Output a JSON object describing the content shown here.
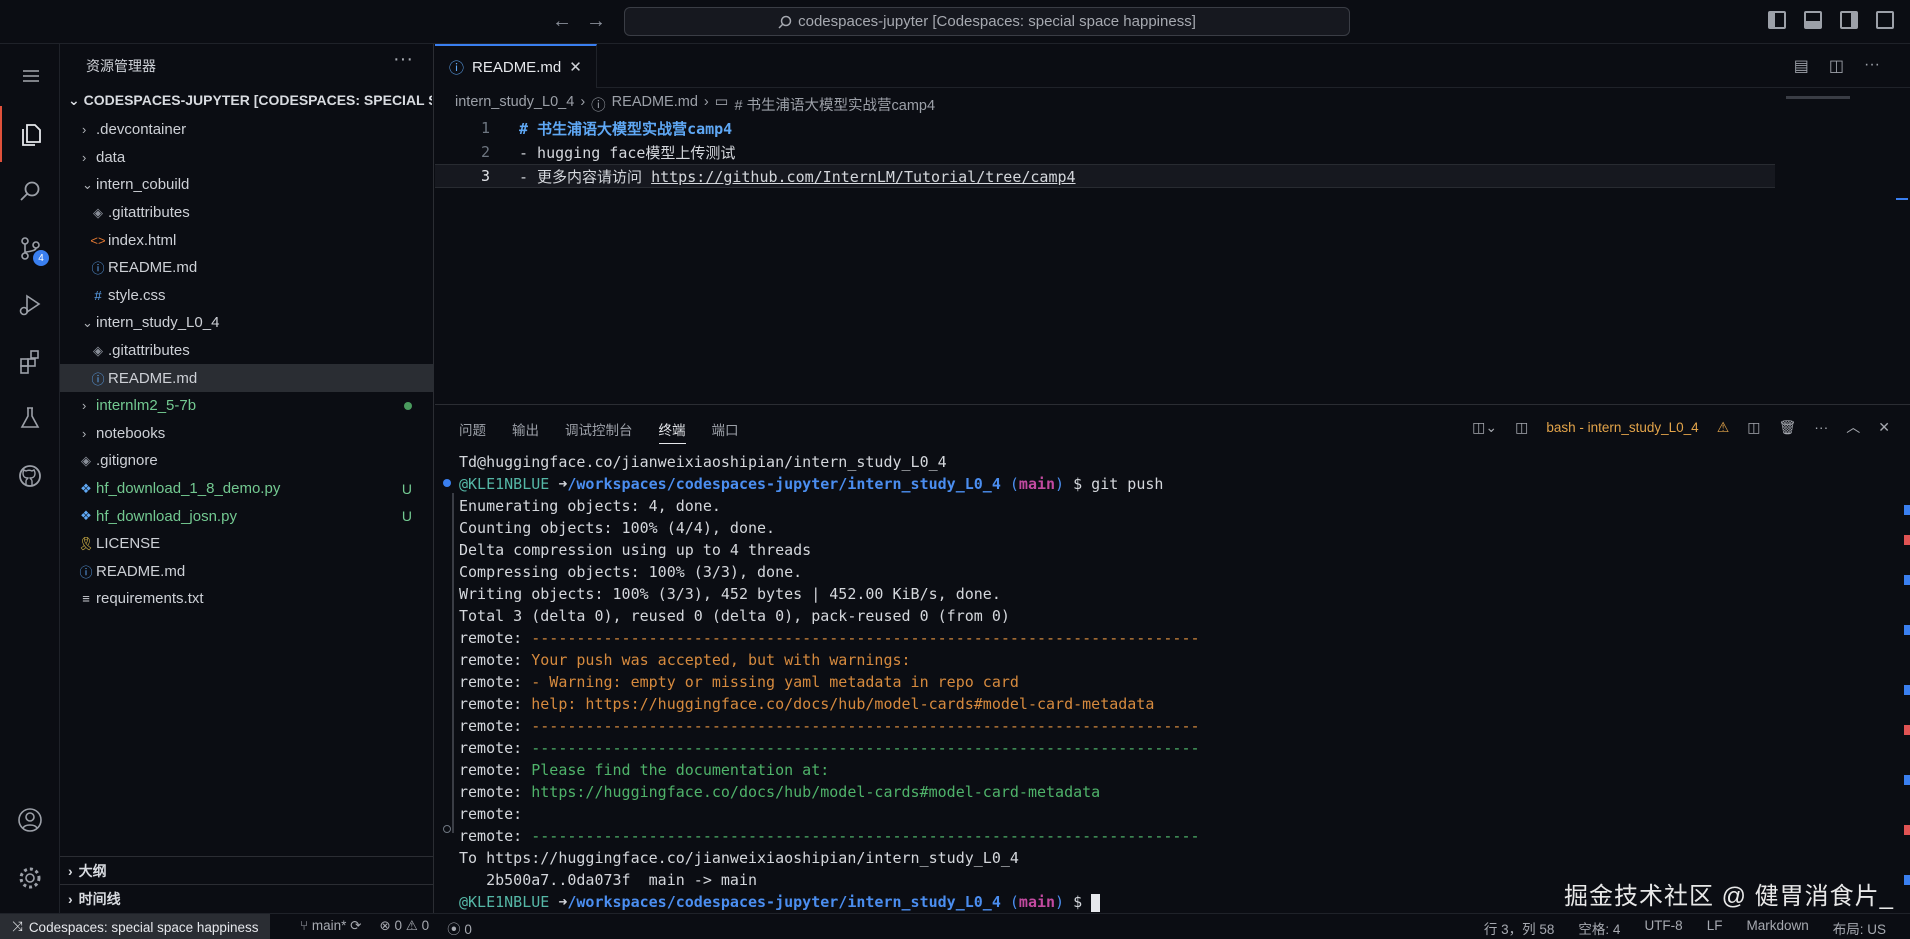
{
  "titlebar": {
    "back": "←",
    "forward": "→",
    "search": "codespaces-jupyter [Codespaces: special space happiness]"
  },
  "activity": {
    "scm_badge": "4"
  },
  "sidebar": {
    "title": "资源管理器",
    "more": "···",
    "root": "CODESPACES-JUPYTER [CODESPACES: SPECIAL SPA...",
    "items": [
      {
        "label": ".devcontainer",
        "type": "folder"
      },
      {
        "label": "data",
        "type": "folder"
      },
      {
        "label": "intern_cobuild",
        "type": "folder-open"
      },
      {
        "label": ".gitattributes",
        "type": "file"
      },
      {
        "label": "index.html",
        "type": "file"
      },
      {
        "label": "README.md",
        "type": "file"
      },
      {
        "label": "style.css",
        "type": "file"
      },
      {
        "label": "intern_study_L0_4",
        "type": "folder-open"
      },
      {
        "label": ".gitattributes",
        "type": "file"
      },
      {
        "label": "README.md",
        "type": "file"
      },
      {
        "label": "internlm2_5-7b",
        "type": "folder"
      },
      {
        "label": "notebooks",
        "type": "folder"
      },
      {
        "label": ".gitignore",
        "type": "file"
      },
      {
        "label": "hf_download_1_8_demo.py",
        "type": "file",
        "status": "U"
      },
      {
        "label": "hf_download_josn.py",
        "type": "file",
        "status": "U"
      },
      {
        "label": "LICENSE",
        "type": "file"
      },
      {
        "label": "README.md",
        "type": "file"
      },
      {
        "label": "requirements.txt",
        "type": "file"
      }
    ],
    "outline": "大纲",
    "timeline": "时间线"
  },
  "editor": {
    "tab": "README.md",
    "breadcrumb": [
      "intern_study_L0_4",
      "README.md",
      "# 书生浦语大模型实战营camp4"
    ],
    "lines": [
      {
        "num": "1",
        "text": "# 书生浦语大模型实战营camp4"
      },
      {
        "num": "2",
        "text": "- hugging face模型上传测试"
      },
      {
        "num": "3",
        "prefix": "- 更多内容请访问 ",
        "link": "https://github.com/InternLM/Tutorial/tree/camp4"
      }
    ]
  },
  "panel": {
    "tabs": [
      "问题",
      "输出",
      "调试控制台",
      "终端",
      "端口"
    ],
    "terminal_name": "bash - intern_study_L0_4",
    "prompt_user": "@KLE1NBLUE",
    "prompt_arrow": "➜",
    "prompt_path": "/workspaces/codespaces-jupyter/intern_study_L0_4",
    "prompt_branch": "main",
    "line0": "Td@huggingface.co/jianweixiaoshipian/intern_study_L0_4",
    "cmd": "$ git push",
    "out": [
      "Enumerating objects: 4, done.",
      "Counting objects: 100% (4/4), done.",
      "Delta compression using up to 4 threads",
      "Compressing objects: 100% (3/3), done.",
      "Writing objects: 100% (3/3), 452 bytes | 452.00 KiB/s, done.",
      "Total 3 (delta 0), reused 0 (delta 0), pack-reused 0 (from 0)"
    ],
    "remote_prefix": "remote: ",
    "dashes": "--------------------------------------------------------------------------",
    "warn1": "Your push was accepted, but with warnings:",
    "warn2": "- Warning: empty or missing yaml metadata in repo card",
    "warn3": "help: https://huggingface.co/docs/hub/model-cards#model-card-metadata",
    "doc1": "Please find the documentation at:",
    "doc2": "https://huggingface.co/docs/hub/model-cards#model-card-metadata",
    "to": "To https://huggingface.co/jianweixiaoshipian/intern_study_L0_4",
    "ref": "   2b500a7..0da073f  main -> main",
    "final_cmd": "$ ",
    "watermark": "掘金技术社区 @ 健胃消食片_"
  },
  "statusbar": {
    "remote": "Codespaces: special space happiness",
    "branch": "main*",
    "errors": "⊗ 0 ⚠ 0",
    "ports": "0",
    "position": "行 3，列 58",
    "spaces": "空格: 4",
    "encoding": "UTF-8",
    "eol": "LF",
    "lang": "Markdown",
    "layout": "布局: US"
  }
}
